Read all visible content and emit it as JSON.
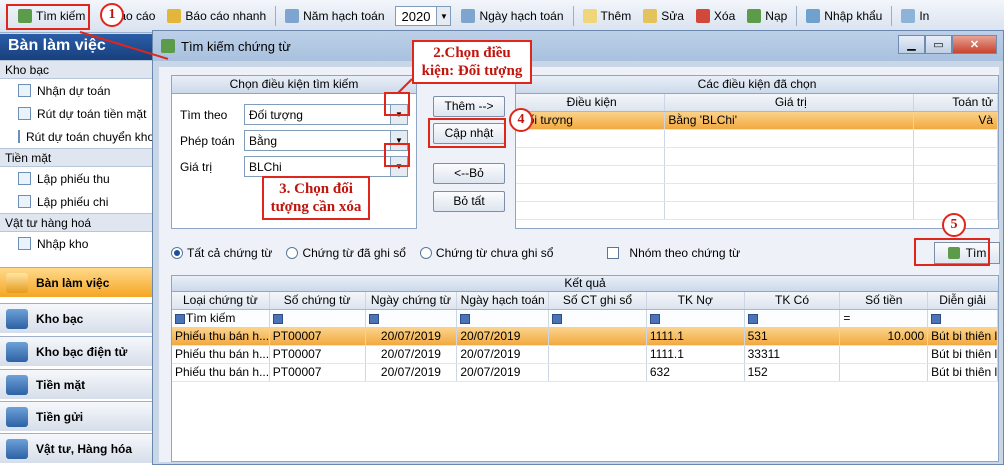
{
  "toolbar": {
    "search": "Tìm kiếm",
    "report": "Báo cáo",
    "quick_report": "Báo cáo nhanh",
    "fiscal_year_label": "Năm hạch toán",
    "fiscal_year_value": "2020",
    "posting_date": "Ngày hạch toán",
    "add": "Thêm",
    "edit": "Sửa",
    "delete": "Xóa",
    "load": "Nạp",
    "import": "Nhập khẩu",
    "print": "In"
  },
  "sidebar": {
    "header": "Bàn làm việc",
    "groups": [
      {
        "label": "Kho bạc",
        "items": [
          "Nhận dự toán",
          "Rút dự toán tiền mặt",
          "Rút dự toán chuyển khoản"
        ]
      },
      {
        "label": "Tiền mặt",
        "items": [
          "Lập phiếu thu",
          "Lập phiếu chi"
        ]
      },
      {
        "label": "Vật tư hàng hoá",
        "items": [
          "Nhập kho"
        ]
      }
    ],
    "nav": [
      "Bàn làm việc",
      "Kho bạc",
      "Kho bạc điện tử",
      "Tiền mặt",
      "Tiền gửi",
      "Vật tư, Hàng hóa"
    ]
  },
  "dialog": {
    "title": "Tìm kiếm chứng từ",
    "criteria_panel_title": "Chọn điều kiện tìm kiếm",
    "search_by_label": "Tìm theo",
    "search_by_value": "Đối tượng",
    "operator_label": "Phép toán",
    "operator_value": "Bằng",
    "value_label": "Giá trị",
    "value_value": "BLChi",
    "btn_add": "Thêm -->",
    "btn_update": "Cập nhật",
    "btn_remove": "<--Bỏ",
    "btn_remove_all": "Bỏ tất",
    "selected_panel_title": "Các điều kiện đã chọn",
    "selected_columns": [
      "Điều kiện",
      "Giá trị",
      "Toán tử"
    ],
    "selected_rows": [
      [
        "Đối tượng",
        "Bằng 'BLChi'",
        "Và"
      ]
    ],
    "radio_all": "Tất cả chứng từ",
    "radio_posted": "Chứng từ đã ghi sổ",
    "radio_unposted": "Chứng từ chưa ghi sổ",
    "group_by_voucher": "Nhóm theo chứng từ",
    "find_button": "Tìm",
    "results_title": "Kết quả",
    "results_columns": [
      "Loại chứng từ",
      "Số chứng từ",
      "Ngày chứng từ",
      "Ngày hạch toán",
      "Số CT ghi sổ",
      "TK Nợ",
      "TK Có",
      "Số tiền",
      "Diễn giải"
    ],
    "filter_first": "Tìm kiếm",
    "filter_amount_op": "=",
    "results_rows": [
      [
        "Phiếu thu bán h...",
        "PT00007",
        "20/07/2019",
        "20/07/2019",
        "",
        "1111.1",
        "531",
        "10.000",
        "Bút bi thiên l"
      ],
      [
        "Phiếu thu bán h...",
        "PT00007",
        "20/07/2019",
        "20/07/2019",
        "",
        "1111.1",
        "33311",
        "",
        "Bút bi thiên l"
      ],
      [
        "Phiếu thu bán h...",
        "PT00007",
        "20/07/2019",
        "20/07/2019",
        "",
        "632",
        "152",
        "",
        "Bút bi thiên l"
      ]
    ]
  },
  "annotations": {
    "step1": "1",
    "step2_text": "2.Chọn điều kiện: Đối tượng",
    "step3_text": "3. Chọn đối tượng cần xóa",
    "step4": "4",
    "step5": "5"
  },
  "colors": {
    "highlight": "#f1a940",
    "annotation_red": "#e0251a",
    "sidebar_header": "#183f7d"
  }
}
